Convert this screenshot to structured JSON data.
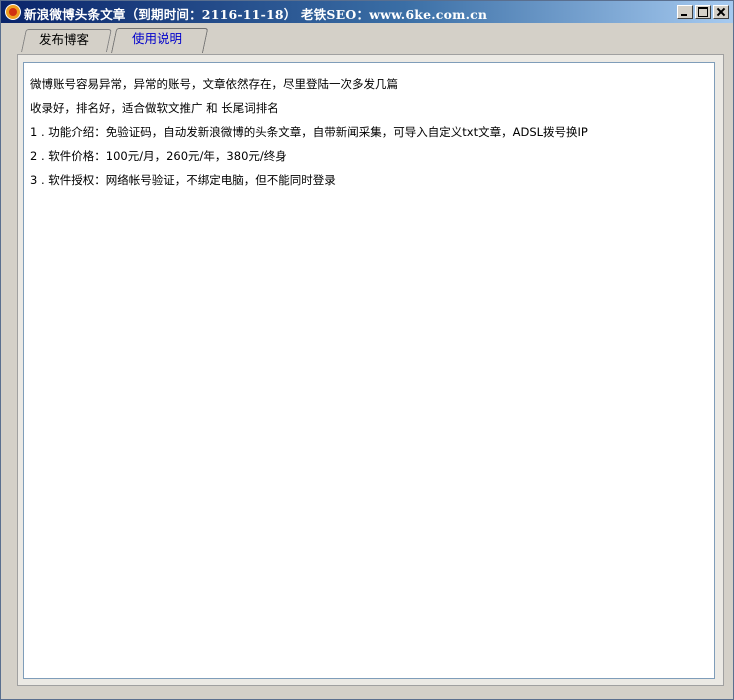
{
  "window": {
    "title": "新浪微博头条文章（到期时间：2116-11-18） 老铁SEO：www.6ke.com.cn",
    "icon": "app-orange-icon",
    "controls": {
      "minimize": "minimize-icon",
      "maximize": "maximize-icon",
      "close": "close-icon"
    }
  },
  "tabs": [
    {
      "label": "发布博客",
      "active": false
    },
    {
      "label": "使用说明",
      "active": true
    }
  ],
  "instructions": {
    "lines": [
      "微博账号容易异常，异常的账号，文章依然存在，尽里登陆一次多发几篇",
      "收录好，排名好，适合做软文推广 和 长尾词排名",
      "1 . 功能介绍：免验证码，自动发新浪微博的头条文章，自带新闻采集，可导入自定义txt文章，ADSL拨号换IP",
      "2 . 软件价格：100元/月，260元/年，380元/终身",
      "3 . 软件授权：网络帐号验证，不绑定电脑，但不能同时登录"
    ]
  },
  "colors": {
    "titlebar_start": "#0a246a",
    "titlebar_end": "#a6caf0",
    "active_tab_text": "#0000cc",
    "window_bg": "#d4d0c8"
  }
}
